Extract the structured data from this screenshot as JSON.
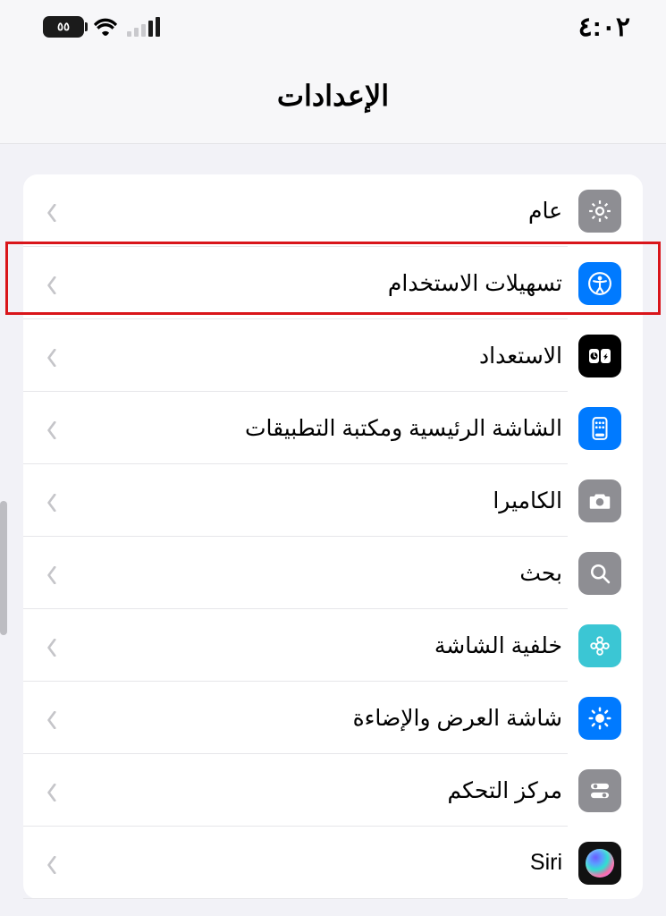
{
  "status": {
    "battery_text": "٥٥",
    "clock": "٤:٠٢"
  },
  "title": "الإعدادات",
  "rows": [
    {
      "id": "general",
      "label": "عام"
    },
    {
      "id": "accessibility",
      "label": "تسهيلات الاستخدام"
    },
    {
      "id": "standby",
      "label": "الاستعداد"
    },
    {
      "id": "home",
      "label": "الشاشة الرئيسية ومكتبة التطبيقات"
    },
    {
      "id": "camera",
      "label": "الكاميرا"
    },
    {
      "id": "search",
      "label": "بحث"
    },
    {
      "id": "wallpaper",
      "label": "خلفية الشاشة"
    },
    {
      "id": "display",
      "label": "شاشة العرض والإضاءة"
    },
    {
      "id": "control",
      "label": "مركز التحكم"
    },
    {
      "id": "siri",
      "label": "Siri"
    }
  ]
}
